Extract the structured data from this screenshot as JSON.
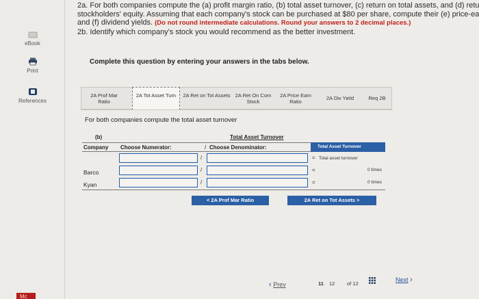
{
  "sidebar": {
    "items": [
      {
        "label": "eBook",
        "icon": "ebook-icon"
      },
      {
        "label": "Print",
        "icon": "printer-icon"
      },
      {
        "label": "References",
        "icon": "references-icon"
      }
    ],
    "brand": "Mc"
  },
  "instructions": {
    "line1": "2a. For both companies compute the (a) profit margin ratio, (b) total asset turnover, (c) return on total assets, and (d) return c",
    "line2": "stockholders' equity. Assuming that each company's stock can be purchased at $80 per share, compute their (e) price-earn",
    "line3_start": "and (f) dividend yields.",
    "line3_red": "(Do not round intermediate calculations. Round your answers to 2 decimal places.)",
    "line4": "2b. Identify which company's stock you would recommend as the better investment.",
    "complete": "Complete this question by entering your answers in the tabs below."
  },
  "tabs": [
    {
      "label": "2A Prof Mar Ratio"
    },
    {
      "label": "2A Tot Asset Turn",
      "active": true
    },
    {
      "label": "2A Ret on Tot Assets"
    },
    {
      "label": "2A Ret On Com Stock"
    },
    {
      "label": "2A Price Earn Ratio"
    },
    {
      "label": "2A Div Yield"
    },
    {
      "label": "Req 2B"
    }
  ],
  "panel": {
    "title": "For both companies compute the total asset turnover",
    "section_label": "(b)",
    "table_title": "Total Asset Turnover",
    "headers": {
      "company": "Company",
      "numerator": "Choose Numerator:",
      "div": "/",
      "denominator": "Choose Denominator:",
      "eq": "=",
      "result": "Total Asset Turnover"
    },
    "rows": [
      {
        "company": "",
        "numerator": "",
        "denominator": "",
        "result": "Total asset turnover"
      },
      {
        "company": "Barco",
        "numerator": "",
        "denominator": "",
        "result": "0 times"
      },
      {
        "company": "Kyan",
        "numerator": "",
        "denominator": "",
        "result": "0 times"
      }
    ],
    "prev_button": "< 2A Prof Mar Ratio",
    "next_button": "2A Ret on Tot Assets >"
  },
  "nav": {
    "prev": "Prev",
    "page_current": "11",
    "page_next": "12",
    "page_total_text": "of 12",
    "next": "Next"
  },
  "colors": {
    "accent": "#2b5fa6",
    "brand": "#b51c1c",
    "warning": "#c0201b"
  }
}
